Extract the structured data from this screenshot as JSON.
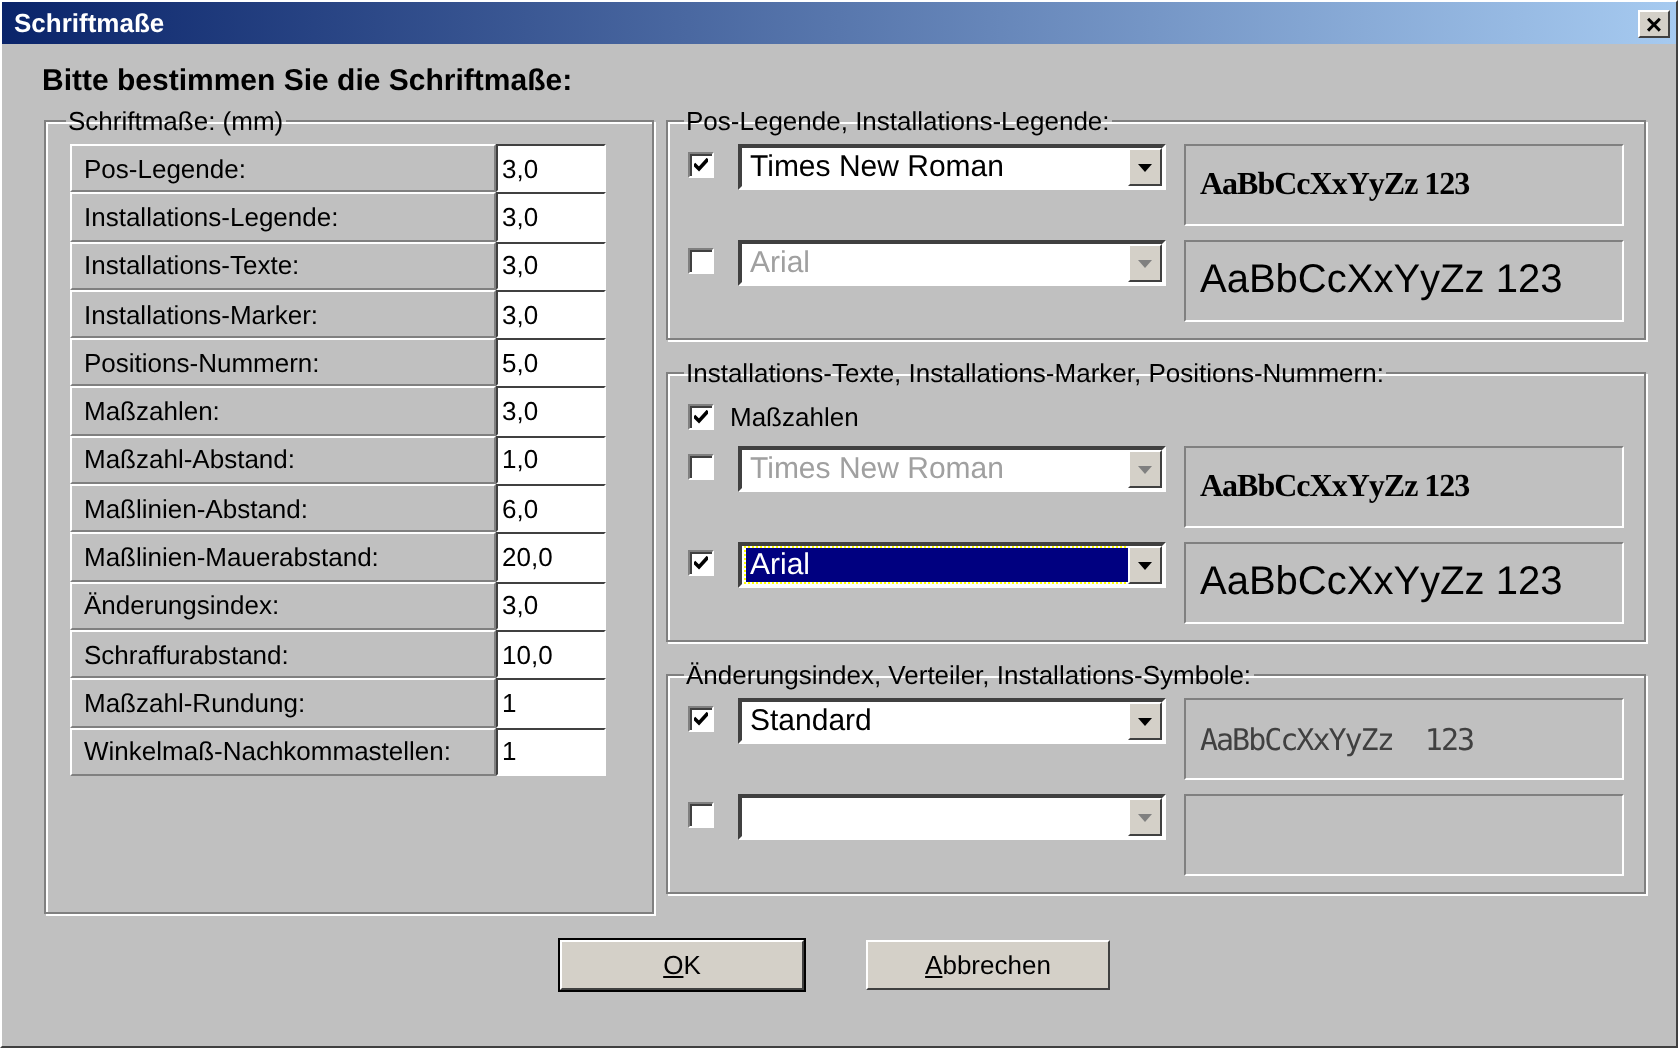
{
  "window": {
    "title": "Schriftmaße",
    "close": "×"
  },
  "heading": "Bitte bestimmen Sie die Schriftmaße:",
  "sizes": {
    "legend": "Schriftmaße: (mm)",
    "rows": [
      {
        "label": "Pos-Legende:",
        "value": "3,0"
      },
      {
        "label": "Installations-Legende:",
        "value": "3,0"
      },
      {
        "label": "Installations-Texte:",
        "value": "3,0"
      },
      {
        "label": "Installations-Marker:",
        "value": "3,0"
      },
      {
        "label": "Positions-Nummern:",
        "value": "5,0"
      },
      {
        "label": "Maßzahlen:",
        "value": "3,0"
      },
      {
        "label": "Maßzahl-Abstand:",
        "value": "1,0"
      },
      {
        "label": "Maßlinien-Abstand:",
        "value": "6,0"
      },
      {
        "label": "Maßlinien-Mauerabstand:",
        "value": "20,0"
      },
      {
        "label": "Änderungsindex:",
        "value": "3,0"
      },
      {
        "label": "Schraffurabstand:",
        "value": "10,0"
      },
      {
        "label": "Maßzahl-Rundung:",
        "value": "1"
      },
      {
        "label": "Winkelmaß-Nachkommastellen:",
        "value": "1"
      }
    ]
  },
  "font_groups": [
    {
      "legend": "Pos-Legende, Installations-Legende:",
      "items": [
        {
          "kind": "font",
          "checked": true,
          "disabled": false,
          "selected": false,
          "font": "Times New Roman",
          "preview": {
            "text": "AaBbCcXxYyZz 123",
            "kind": "serif"
          }
        },
        {
          "kind": "font",
          "checked": false,
          "disabled": true,
          "selected": false,
          "font": "Arial",
          "preview": {
            "text": "AaBbCcXxYyZz 123",
            "kind": "sans"
          }
        }
      ]
    },
    {
      "legend": "Installations-Texte, Installations-Marker, Positions-Nummern:",
      "items": [
        {
          "kind": "checkbox",
          "checked": true,
          "label": "Maßzahlen"
        },
        {
          "kind": "font",
          "checked": false,
          "disabled": true,
          "selected": false,
          "font": "Times New Roman",
          "preview": {
            "text": "AaBbCcXxYyZz 123",
            "kind": "serif"
          }
        },
        {
          "kind": "font",
          "checked": true,
          "disabled": false,
          "selected": true,
          "font": "Arial",
          "preview": {
            "text": "AaBbCcXxYyZz 123",
            "kind": "sans"
          }
        }
      ]
    },
    {
      "legend": "Änderungsindex, Verteiler, Installations-Symbole:",
      "items": [
        {
          "kind": "font",
          "checked": true,
          "disabled": false,
          "selected": false,
          "font": "Standard",
          "preview": {
            "text": "AaBbCcXxYyZz  123",
            "kind": "stroke"
          }
        },
        {
          "kind": "font",
          "checked": false,
          "disabled": true,
          "selected": false
        }
      ]
    }
  ],
  "buttons": [
    {
      "label": "OK",
      "mnemonic": true
    },
    {
      "label": "Abbrechen",
      "mnemonic": true
    }
  ]
}
